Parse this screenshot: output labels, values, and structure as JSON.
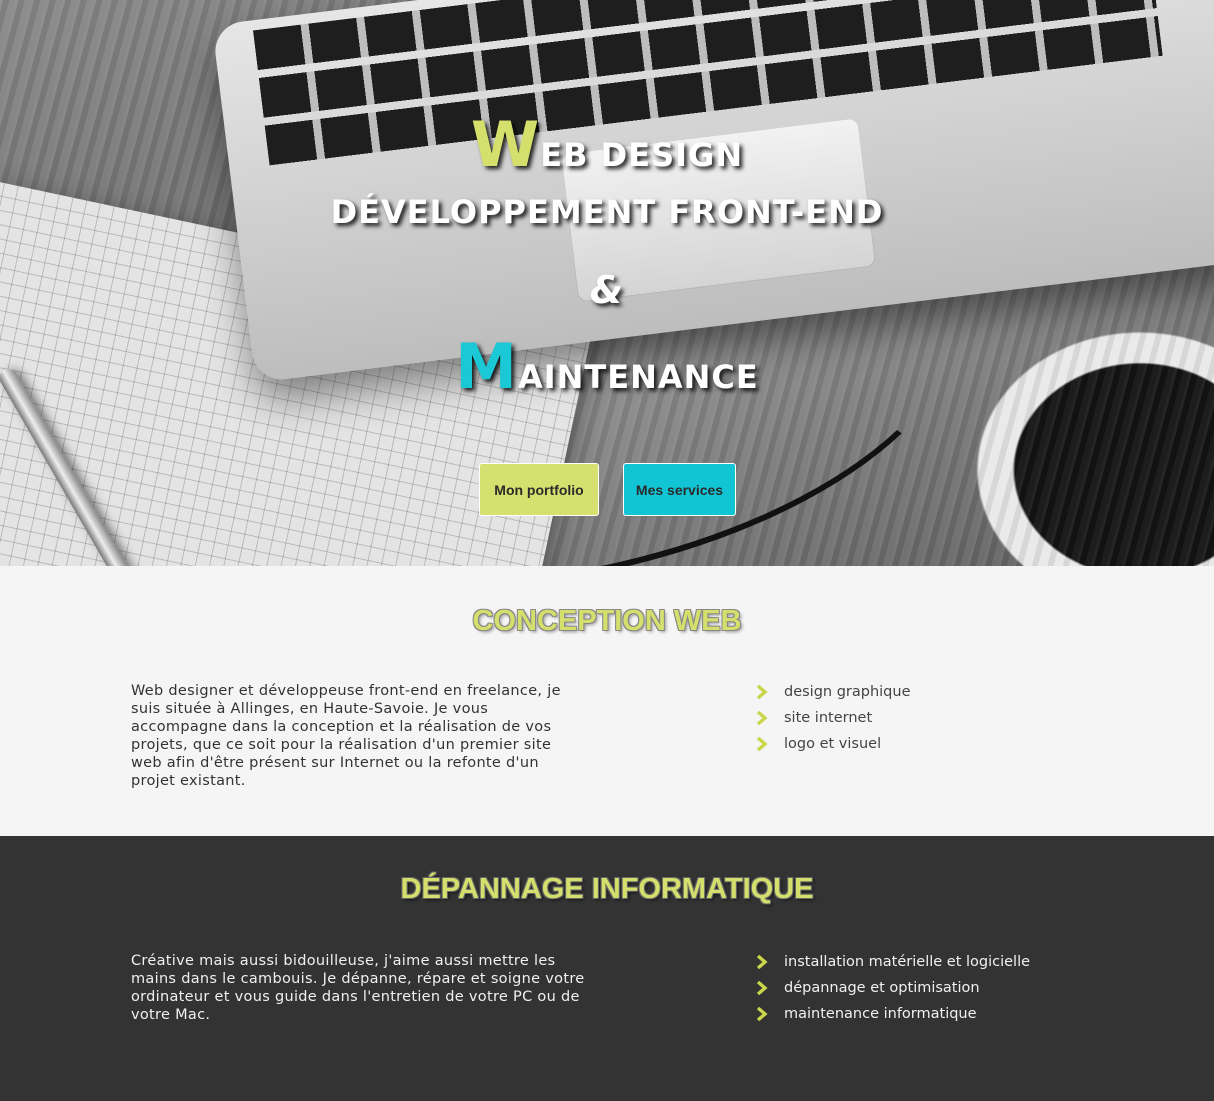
{
  "hero": {
    "line1_cap": "W",
    "line1_rest": "EB DESIGN",
    "line2": "DÉVELOPPEMENT FRONT-END",
    "line3": "&",
    "line4_cap": "M",
    "line4_rest": "AINTENANCE",
    "buttons": {
      "portfolio": "Mon portfolio",
      "services": "Mes services"
    }
  },
  "colors": {
    "accent_green": "#d4e06b",
    "accent_cyan": "#1ac8d6",
    "dark_section": "#333333",
    "light_section": "#f5f5f5"
  },
  "conception": {
    "title": "CONCEPTION WEB",
    "text": "Web designer et développeuse front-end en freelance, je suis située à Allinges, en Haute-Savoie. Je vous accompagne dans la conception et la réalisation de vos projets, que ce soit pour la réalisation d'un premier site web afin d'être présent sur Internet ou la refonte d'un projet existant.",
    "items": [
      {
        "icon": "chevron-right-icon",
        "label": "design graphique"
      },
      {
        "icon": "chevron-right-icon",
        "label": "site internet"
      },
      {
        "icon": "chevron-right-icon",
        "label": "logo et visuel"
      }
    ]
  },
  "depannage": {
    "title": "DÉPANNAGE INFORMATIQUE",
    "text": "Créative mais aussi bidouilleuse, j'aime aussi mettre les mains dans le cambouis. Je dépanne, répare et soigne votre ordinateur et vous guide dans l'entretien de votre PC ou de votre Mac.",
    "items": [
      {
        "icon": "chevron-right-icon",
        "label": "installation matérielle et logicielle"
      },
      {
        "icon": "chevron-right-icon",
        "label": "dépannage et optimisation"
      },
      {
        "icon": "chevron-right-icon",
        "label": "maintenance informatique"
      }
    ]
  }
}
